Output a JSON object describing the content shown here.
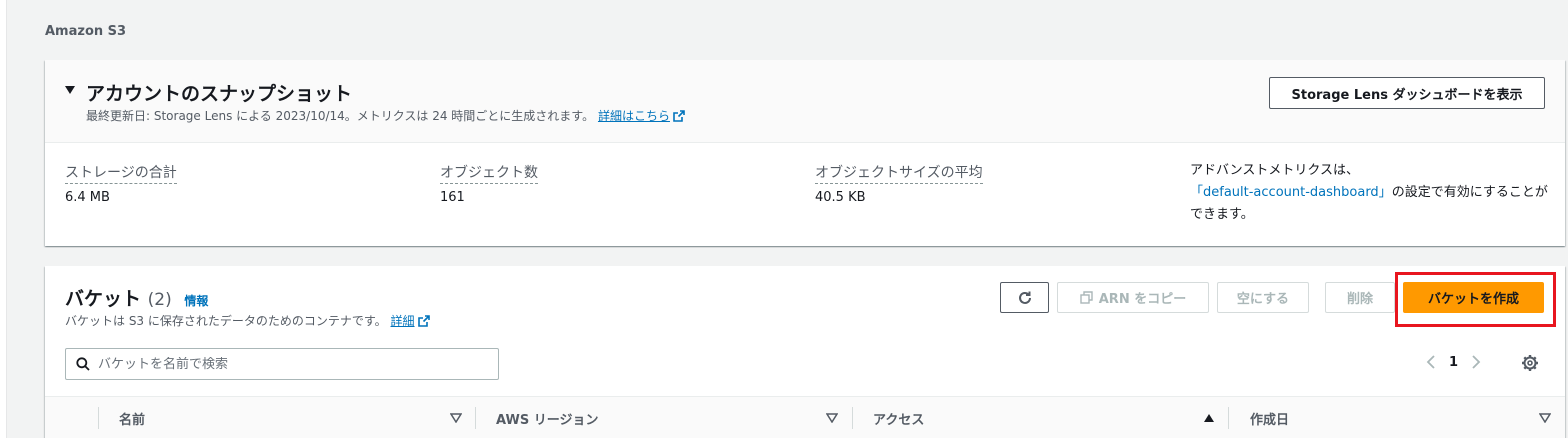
{
  "service_title": "Amazon S3",
  "snapshot": {
    "title": "アカウントのスナップショット",
    "description": "最終更新日: Storage Lens による 2023/10/14。メトリクスは 24 時間ごとに生成されます。",
    "details_link": "詳細はこちら",
    "lens_button": "Storage Lens ダッシュボードを表示",
    "metrics": [
      {
        "label": "ストレージの合計",
        "value": "6.4 MB"
      },
      {
        "label": "オブジェクト数",
        "value": "161"
      },
      {
        "label": "オブジェクトサイズの平均",
        "value": "40.5 KB"
      }
    ],
    "advanced_prefix": "アドバンストメトリクスは、",
    "advanced_dashboard": "「default-account-dashboard」",
    "advanced_suffix": "の設定で有効にすることができます。"
  },
  "buckets": {
    "title": "バケット",
    "count": "(2)",
    "info_link": "情報",
    "description": "バケットは S3 に保存されたデータのためのコンテナです。",
    "details_link": "詳細",
    "buttons": {
      "copy_arn": "ARN をコピー",
      "empty": "空にする",
      "delete": "削除",
      "create": "バケットを作成"
    },
    "search_placeholder": "バケットを名前で検索",
    "page_number": "1",
    "columns": [
      "名前",
      "AWS リージョン",
      "アクセス",
      "作成日"
    ],
    "highlight_color": "#e8161f",
    "accent_color": "#ff9900"
  }
}
